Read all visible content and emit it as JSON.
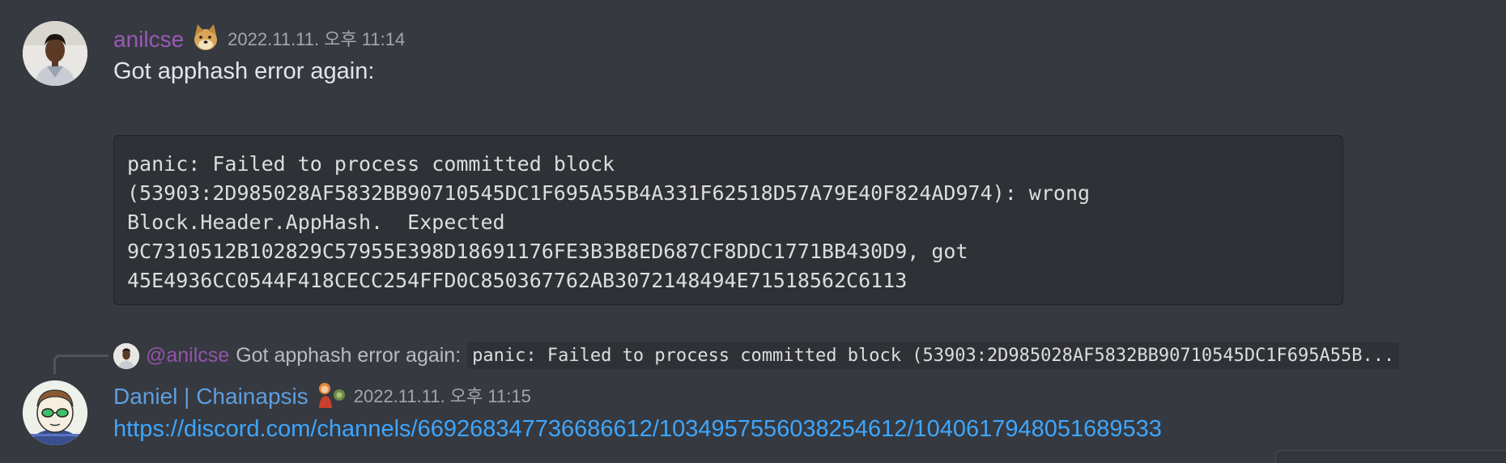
{
  "messages": [
    {
      "author": "anilcse",
      "author_color": "#9b59b6",
      "timestamp": "2022.11.11. 오후 11:14",
      "text": "Got apphash error again:",
      "code_lines": [
        "panic: Failed to process committed block",
        "(53903:2D985028AF5832BB90710545DC1F695A55B4A331F62518D57A79E40F824AD974): wrong",
        "Block.Header.AppHash.  Expected",
        "9C7310512B102829C57955E398D18691176FE3B3B8ED687CF8DDC1771BB430D9, got",
        "45E4936CC0544F418CECC254FFD0C850367762AB3072148494E71518562C6113"
      ],
      "badge_icon": "doge-emoji-icon"
    },
    {
      "author": "Daniel | Chainapsis",
      "author_color": "#5e9fe0",
      "timestamp": "2022.11.11. 오후 11:15",
      "reply": {
        "author": "@anilcse",
        "text": "Got apphash error again:",
        "code_preview": "panic: Failed to process committed block (53903:2D985028AF5832BB90710545DC1F695A55B..."
      },
      "link": "https://discord.com/channels/669268347736686612/1034957556038254612/1040617948051689533",
      "badge_icon": "character-emoji-icon"
    }
  ],
  "colors": {
    "background": "#36393f",
    "code_background": "#2f3136",
    "link": "#3ea6ff",
    "timestamp": "#a3a6aa"
  }
}
